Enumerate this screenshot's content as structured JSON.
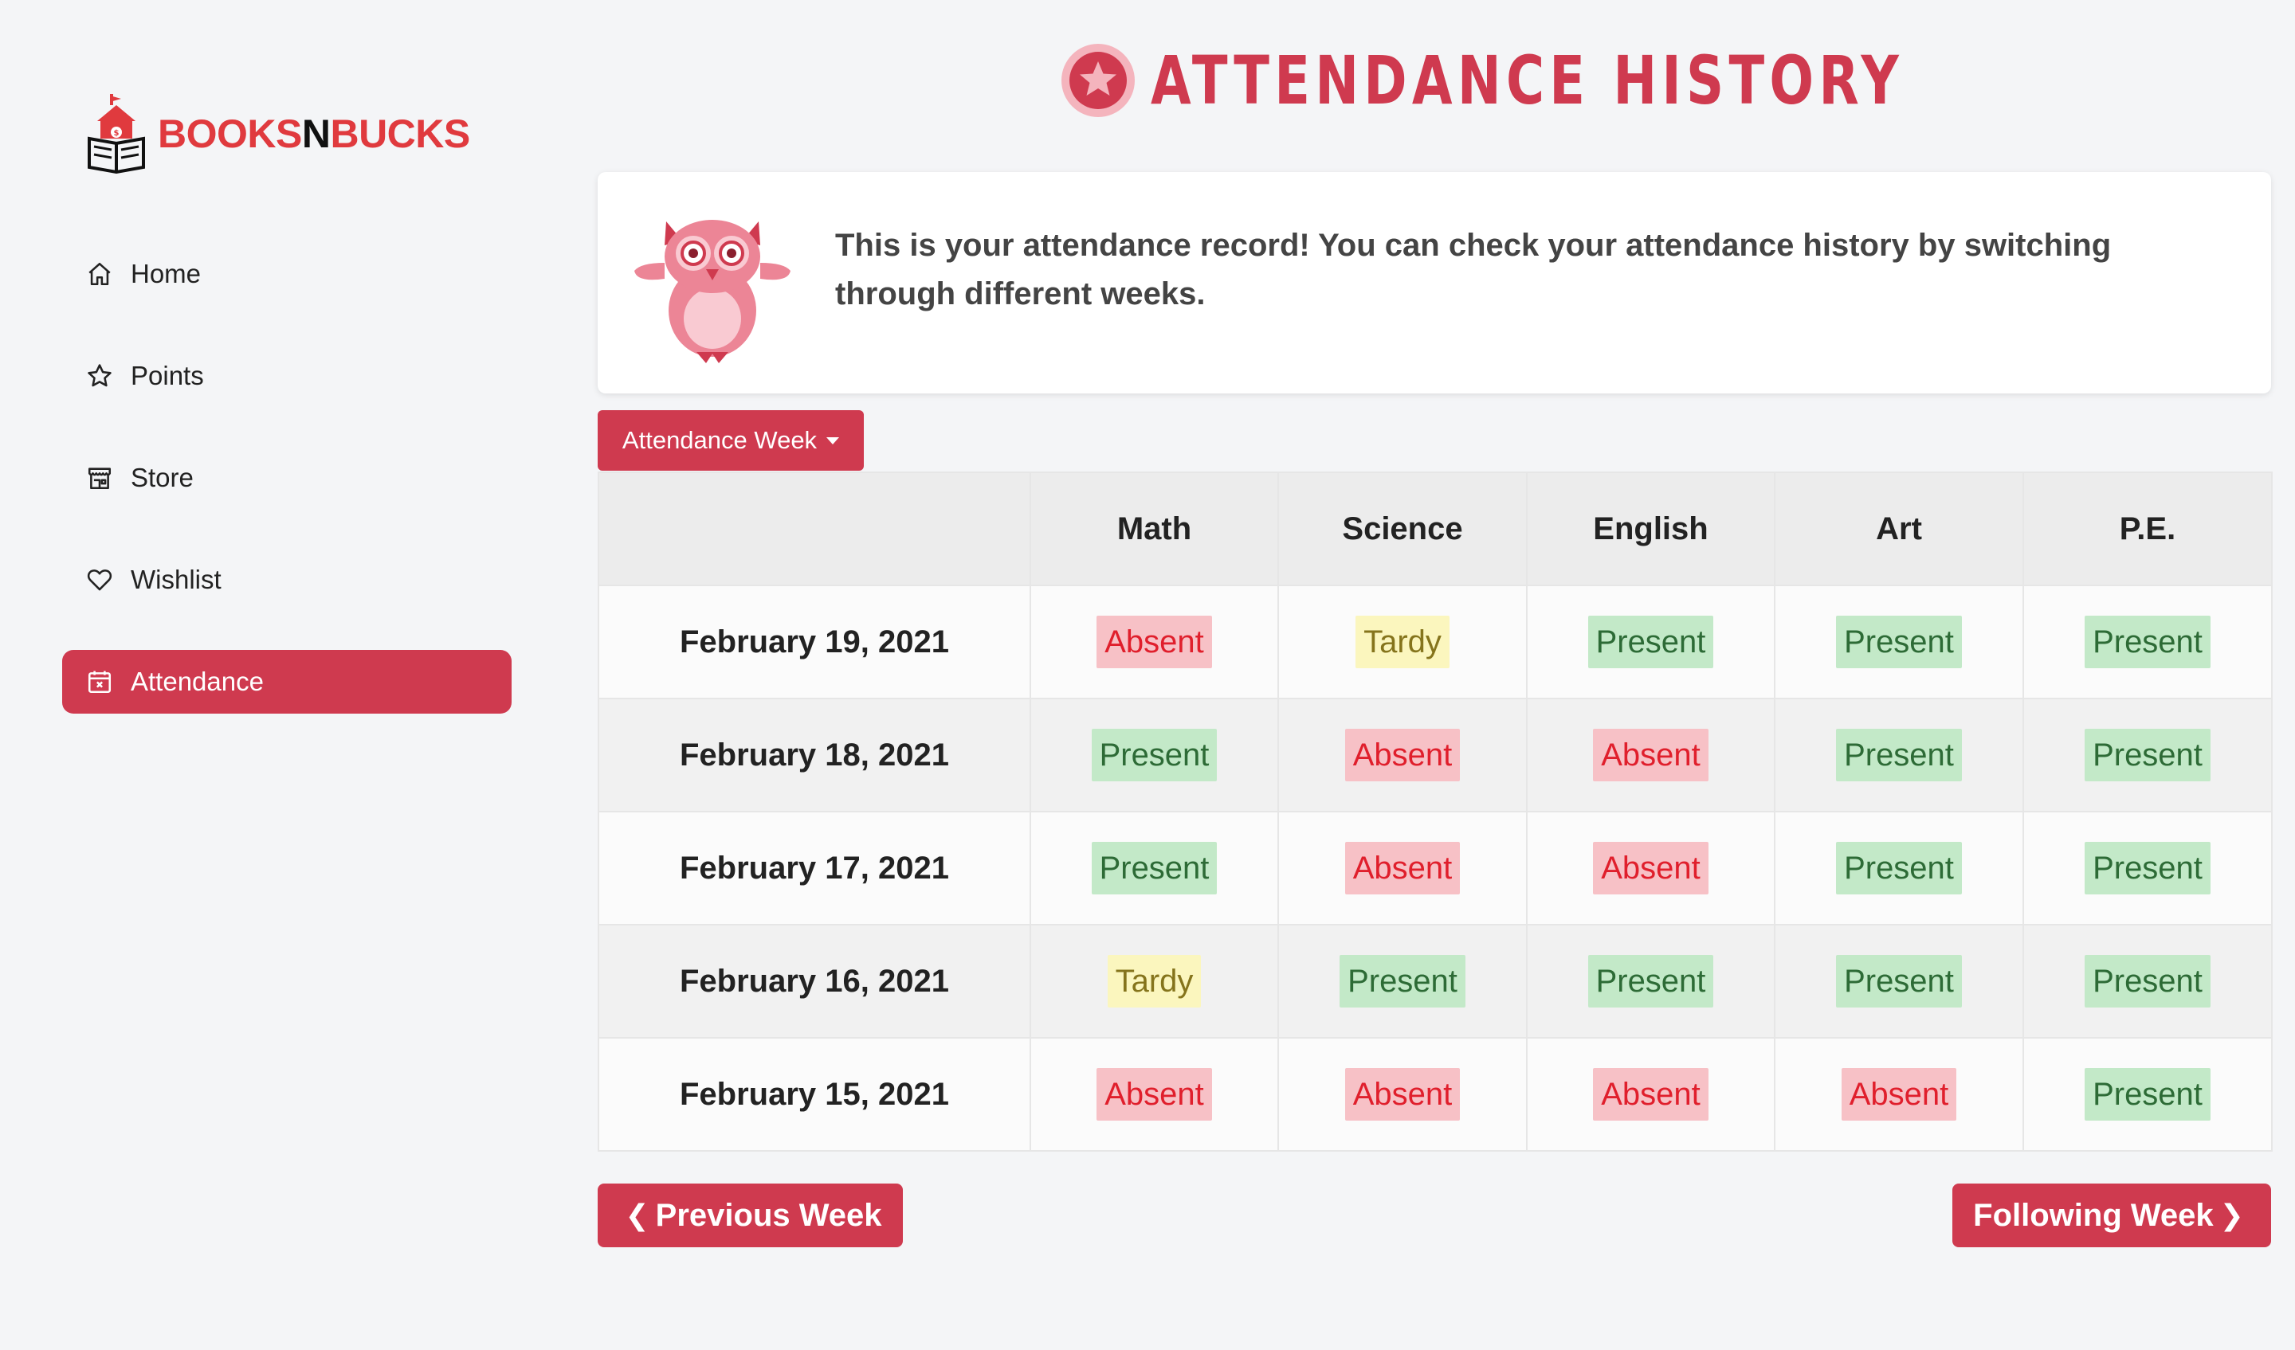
{
  "brand": {
    "part1": "BOOKS",
    "part2": "N",
    "part3": "BUCKS"
  },
  "sidebar": {
    "items": [
      {
        "label": "Home",
        "icon": "home-icon",
        "active": false
      },
      {
        "label": "Points",
        "icon": "star-icon",
        "active": false
      },
      {
        "label": "Store",
        "icon": "store-icon",
        "active": false
      },
      {
        "label": "Wishlist",
        "icon": "heart-icon",
        "active": false
      },
      {
        "label": "Attendance",
        "icon": "calendar-icon",
        "active": true
      }
    ]
  },
  "header": {
    "title": "ATTENDANCE HISTORY",
    "icon": "star-badge-icon"
  },
  "info": {
    "text": "This is your attendance record! You can check your attendance history by switching through different weeks.",
    "mascot": "owl-mascot"
  },
  "week_dropdown": {
    "label": "Attendance Week"
  },
  "table": {
    "columns": [
      "",
      "Math",
      "Science",
      "English",
      "Art",
      "P.E."
    ],
    "rows": [
      {
        "date": "February 19, 2021",
        "cells": [
          "Absent",
          "Tardy",
          "Present",
          "Present",
          "Present"
        ]
      },
      {
        "date": "February 18, 2021",
        "cells": [
          "Present",
          "Absent",
          "Absent",
          "Present",
          "Present"
        ]
      },
      {
        "date": "February 17, 2021",
        "cells": [
          "Present",
          "Absent",
          "Absent",
          "Present",
          "Present"
        ]
      },
      {
        "date": "February 16, 2021",
        "cells": [
          "Tardy",
          "Present",
          "Present",
          "Present",
          "Present"
        ]
      },
      {
        "date": "February 15, 2021",
        "cells": [
          "Absent",
          "Absent",
          "Absent",
          "Absent",
          "Present"
        ]
      }
    ]
  },
  "pager": {
    "prev_label": "Previous Week",
    "prev_arrow": "❮",
    "next_label": "Following Week",
    "next_arrow": "❯"
  },
  "colors": {
    "accent": "#cf3a4f",
    "brand_red": "#e03a3e",
    "present_bg": "#c3e9c8",
    "absent_bg": "#f7c1c6",
    "tardy_bg": "#fbf6be"
  }
}
